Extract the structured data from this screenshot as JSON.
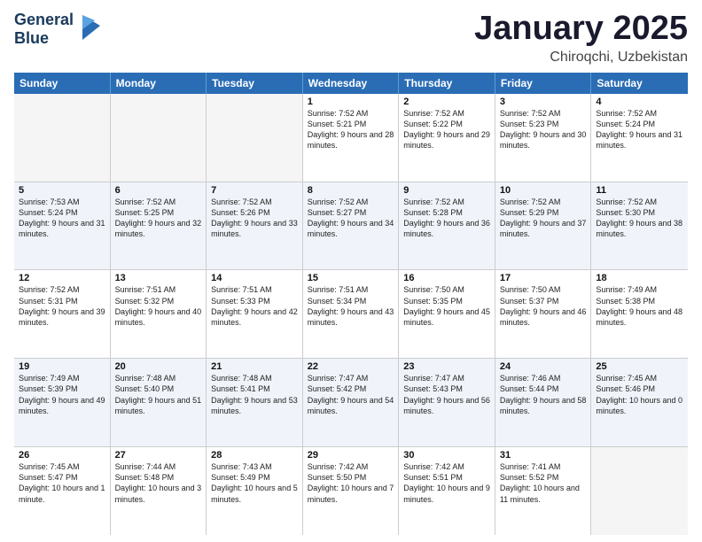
{
  "logo": {
    "line1": "General",
    "line2": "Blue"
  },
  "header": {
    "month": "January 2025",
    "location": "Chiroqchi, Uzbekistan"
  },
  "weekdays": [
    "Sunday",
    "Monday",
    "Tuesday",
    "Wednesday",
    "Thursday",
    "Friday",
    "Saturday"
  ],
  "weeks": [
    [
      {
        "day": "",
        "sunrise": "",
        "sunset": "",
        "daylight": "",
        "empty": true
      },
      {
        "day": "",
        "sunrise": "",
        "sunset": "",
        "daylight": "",
        "empty": true
      },
      {
        "day": "",
        "sunrise": "",
        "sunset": "",
        "daylight": "",
        "empty": true
      },
      {
        "day": "1",
        "sunrise": "Sunrise: 7:52 AM",
        "sunset": "Sunset: 5:21 PM",
        "daylight": "Daylight: 9 hours and 28 minutes.",
        "empty": false
      },
      {
        "day": "2",
        "sunrise": "Sunrise: 7:52 AM",
        "sunset": "Sunset: 5:22 PM",
        "daylight": "Daylight: 9 hours and 29 minutes.",
        "empty": false
      },
      {
        "day": "3",
        "sunrise": "Sunrise: 7:52 AM",
        "sunset": "Sunset: 5:23 PM",
        "daylight": "Daylight: 9 hours and 30 minutes.",
        "empty": false
      },
      {
        "day": "4",
        "sunrise": "Sunrise: 7:52 AM",
        "sunset": "Sunset: 5:24 PM",
        "daylight": "Daylight: 9 hours and 31 minutes.",
        "empty": false
      }
    ],
    [
      {
        "day": "5",
        "sunrise": "Sunrise: 7:53 AM",
        "sunset": "Sunset: 5:24 PM",
        "daylight": "Daylight: 9 hours and 31 minutes.",
        "empty": false
      },
      {
        "day": "6",
        "sunrise": "Sunrise: 7:52 AM",
        "sunset": "Sunset: 5:25 PM",
        "daylight": "Daylight: 9 hours and 32 minutes.",
        "empty": false
      },
      {
        "day": "7",
        "sunrise": "Sunrise: 7:52 AM",
        "sunset": "Sunset: 5:26 PM",
        "daylight": "Daylight: 9 hours and 33 minutes.",
        "empty": false
      },
      {
        "day": "8",
        "sunrise": "Sunrise: 7:52 AM",
        "sunset": "Sunset: 5:27 PM",
        "daylight": "Daylight: 9 hours and 34 minutes.",
        "empty": false
      },
      {
        "day": "9",
        "sunrise": "Sunrise: 7:52 AM",
        "sunset": "Sunset: 5:28 PM",
        "daylight": "Daylight: 9 hours and 36 minutes.",
        "empty": false
      },
      {
        "day": "10",
        "sunrise": "Sunrise: 7:52 AM",
        "sunset": "Sunset: 5:29 PM",
        "daylight": "Daylight: 9 hours and 37 minutes.",
        "empty": false
      },
      {
        "day": "11",
        "sunrise": "Sunrise: 7:52 AM",
        "sunset": "Sunset: 5:30 PM",
        "daylight": "Daylight: 9 hours and 38 minutes.",
        "empty": false
      }
    ],
    [
      {
        "day": "12",
        "sunrise": "Sunrise: 7:52 AM",
        "sunset": "Sunset: 5:31 PM",
        "daylight": "Daylight: 9 hours and 39 minutes.",
        "empty": false
      },
      {
        "day": "13",
        "sunrise": "Sunrise: 7:51 AM",
        "sunset": "Sunset: 5:32 PM",
        "daylight": "Daylight: 9 hours and 40 minutes.",
        "empty": false
      },
      {
        "day": "14",
        "sunrise": "Sunrise: 7:51 AM",
        "sunset": "Sunset: 5:33 PM",
        "daylight": "Daylight: 9 hours and 42 minutes.",
        "empty": false
      },
      {
        "day": "15",
        "sunrise": "Sunrise: 7:51 AM",
        "sunset": "Sunset: 5:34 PM",
        "daylight": "Daylight: 9 hours and 43 minutes.",
        "empty": false
      },
      {
        "day": "16",
        "sunrise": "Sunrise: 7:50 AM",
        "sunset": "Sunset: 5:35 PM",
        "daylight": "Daylight: 9 hours and 45 minutes.",
        "empty": false
      },
      {
        "day": "17",
        "sunrise": "Sunrise: 7:50 AM",
        "sunset": "Sunset: 5:37 PM",
        "daylight": "Daylight: 9 hours and 46 minutes.",
        "empty": false
      },
      {
        "day": "18",
        "sunrise": "Sunrise: 7:49 AM",
        "sunset": "Sunset: 5:38 PM",
        "daylight": "Daylight: 9 hours and 48 minutes.",
        "empty": false
      }
    ],
    [
      {
        "day": "19",
        "sunrise": "Sunrise: 7:49 AM",
        "sunset": "Sunset: 5:39 PM",
        "daylight": "Daylight: 9 hours and 49 minutes.",
        "empty": false
      },
      {
        "day": "20",
        "sunrise": "Sunrise: 7:48 AM",
        "sunset": "Sunset: 5:40 PM",
        "daylight": "Daylight: 9 hours and 51 minutes.",
        "empty": false
      },
      {
        "day": "21",
        "sunrise": "Sunrise: 7:48 AM",
        "sunset": "Sunset: 5:41 PM",
        "daylight": "Daylight: 9 hours and 53 minutes.",
        "empty": false
      },
      {
        "day": "22",
        "sunrise": "Sunrise: 7:47 AM",
        "sunset": "Sunset: 5:42 PM",
        "daylight": "Daylight: 9 hours and 54 minutes.",
        "empty": false
      },
      {
        "day": "23",
        "sunrise": "Sunrise: 7:47 AM",
        "sunset": "Sunset: 5:43 PM",
        "daylight": "Daylight: 9 hours and 56 minutes.",
        "empty": false
      },
      {
        "day": "24",
        "sunrise": "Sunrise: 7:46 AM",
        "sunset": "Sunset: 5:44 PM",
        "daylight": "Daylight: 9 hours and 58 minutes.",
        "empty": false
      },
      {
        "day": "25",
        "sunrise": "Sunrise: 7:45 AM",
        "sunset": "Sunset: 5:46 PM",
        "daylight": "Daylight: 10 hours and 0 minutes.",
        "empty": false
      }
    ],
    [
      {
        "day": "26",
        "sunrise": "Sunrise: 7:45 AM",
        "sunset": "Sunset: 5:47 PM",
        "daylight": "Daylight: 10 hours and 1 minute.",
        "empty": false
      },
      {
        "day": "27",
        "sunrise": "Sunrise: 7:44 AM",
        "sunset": "Sunset: 5:48 PM",
        "daylight": "Daylight: 10 hours and 3 minutes.",
        "empty": false
      },
      {
        "day": "28",
        "sunrise": "Sunrise: 7:43 AM",
        "sunset": "Sunset: 5:49 PM",
        "daylight": "Daylight: 10 hours and 5 minutes.",
        "empty": false
      },
      {
        "day": "29",
        "sunrise": "Sunrise: 7:42 AM",
        "sunset": "Sunset: 5:50 PM",
        "daylight": "Daylight: 10 hours and 7 minutes.",
        "empty": false
      },
      {
        "day": "30",
        "sunrise": "Sunrise: 7:42 AM",
        "sunset": "Sunset: 5:51 PM",
        "daylight": "Daylight: 10 hours and 9 minutes.",
        "empty": false
      },
      {
        "day": "31",
        "sunrise": "Sunrise: 7:41 AM",
        "sunset": "Sunset: 5:52 PM",
        "daylight": "Daylight: 10 hours and 11 minutes.",
        "empty": false
      },
      {
        "day": "",
        "sunrise": "",
        "sunset": "",
        "daylight": "",
        "empty": true
      }
    ]
  ]
}
